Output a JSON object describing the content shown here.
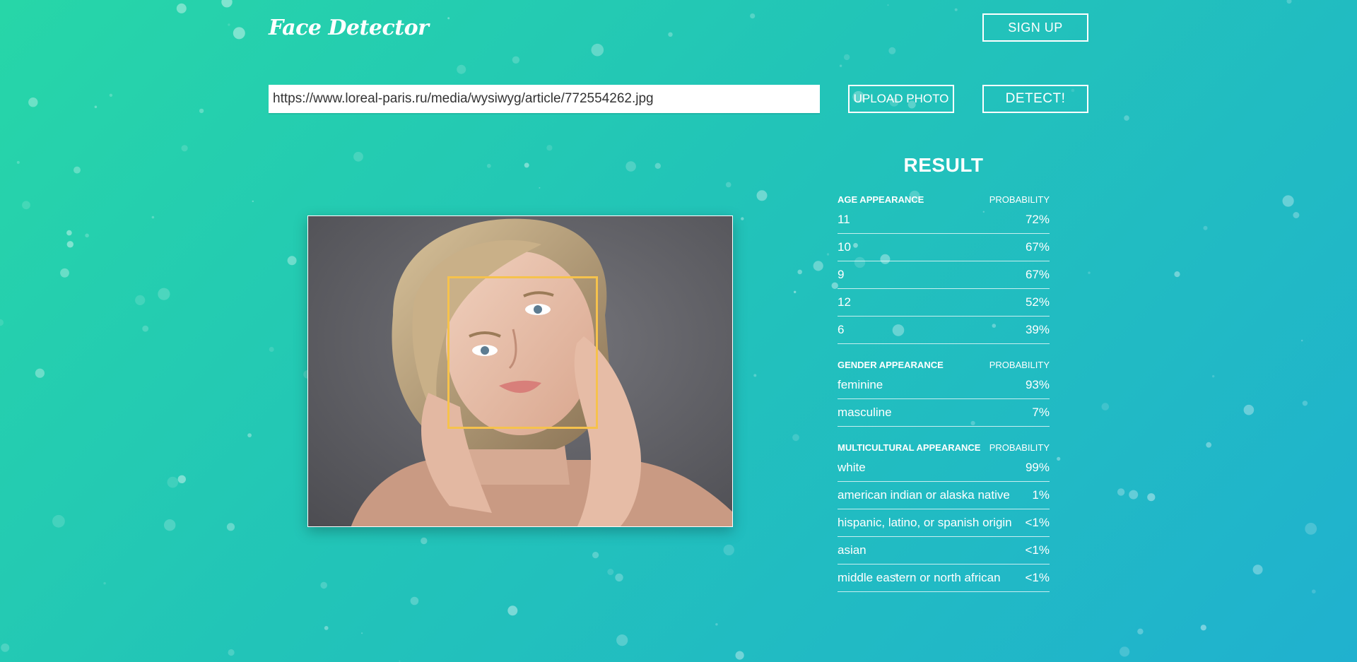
{
  "app": {
    "title": "Face Detector"
  },
  "header": {
    "signup_label": "SIGN UP"
  },
  "toolbar": {
    "url_value": "https://www.loreal-paris.ru/media/wysiwyg/article/772554262.jpg",
    "upload_label": "UPLOAD PHOTO",
    "detect_label": "DETECT!"
  },
  "result": {
    "title": "RESULT",
    "sections": [
      {
        "category": "AGE APPEARANCE",
        "probability_label": "PROBABILITY",
        "rows": [
          {
            "label": "11",
            "value": "72%"
          },
          {
            "label": "10",
            "value": "67%"
          },
          {
            "label": "9",
            "value": "67%"
          },
          {
            "label": "12",
            "value": "52%"
          },
          {
            "label": "6",
            "value": "39%"
          }
        ]
      },
      {
        "category": "GENDER APPEARANCE",
        "probability_label": "PROBABILITY",
        "rows": [
          {
            "label": "feminine",
            "value": "93%"
          },
          {
            "label": "masculine",
            "value": "7%"
          }
        ]
      },
      {
        "category": "MULTICULTURAL APPEARANCE",
        "probability_label": "PROBABILITY",
        "rows": [
          {
            "label": "white",
            "value": "99%"
          },
          {
            "label": "american indian or alaska native",
            "value": "1%"
          },
          {
            "label": "hispanic, latino, or spanish origin",
            "value": "<1%"
          },
          {
            "label": "asian",
            "value": "<1%"
          },
          {
            "label": "middle eastern or north african",
            "value": "<1%"
          }
        ]
      }
    ]
  },
  "colors": {
    "background_start": "#27d6a8",
    "background_end": "#20b1cf",
    "face_box": "#f6c24c",
    "text": "#ffffff"
  }
}
